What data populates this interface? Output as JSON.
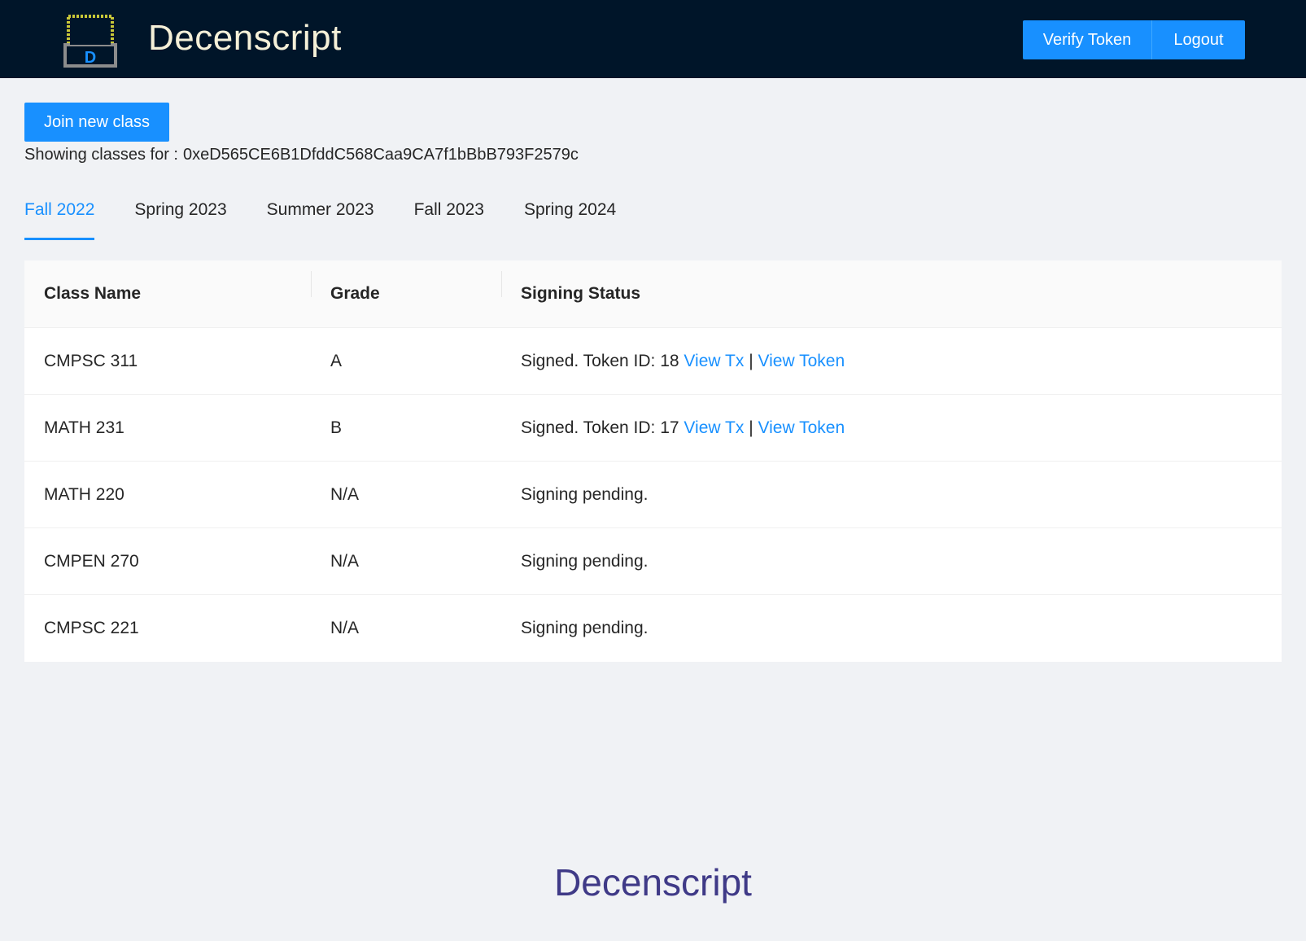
{
  "header": {
    "logo_letter": "D",
    "brand": "Decenscript",
    "verify_label": "Verify Token",
    "logout_label": "Logout"
  },
  "main": {
    "join_label": "Join new class",
    "showing_prefix": "Showing classes for :",
    "address": "0xeD565CE6B1DfddC568Caa9CA7f1bBbB793F2579c",
    "tabs": [
      {
        "label": "Fall 2022",
        "active": true
      },
      {
        "label": "Spring 2023",
        "active": false
      },
      {
        "label": "Summer 2023",
        "active": false
      },
      {
        "label": "Fall 2023",
        "active": false
      },
      {
        "label": "Spring 2024",
        "active": false
      }
    ],
    "table": {
      "headers": [
        "Class Name",
        "Grade",
        "Signing Status"
      ],
      "rows": [
        {
          "class": "CMPSC 311",
          "grade": "A",
          "status": "Signed. Token ID: 18",
          "view_tx": "View Tx",
          "sep": "|",
          "view_token": "View Token"
        },
        {
          "class": "MATH 231",
          "grade": "B",
          "status": "Signed. Token ID: 17",
          "view_tx": "View Tx",
          "sep": "|",
          "view_token": "View Token"
        },
        {
          "class": "MATH 220",
          "grade": "N/A",
          "status": "Signing pending."
        },
        {
          "class": "CMPEN 270",
          "grade": "N/A",
          "status": "Signing pending."
        },
        {
          "class": "CMPSC 221",
          "grade": "N/A",
          "status": "Signing pending."
        }
      ]
    }
  },
  "footer": {
    "brand": "Decenscript"
  },
  "colors": {
    "header_bg": "#001529",
    "primary": "#1890ff",
    "page_bg": "#f0f2f5",
    "footer_text": "#3f3a87"
  }
}
